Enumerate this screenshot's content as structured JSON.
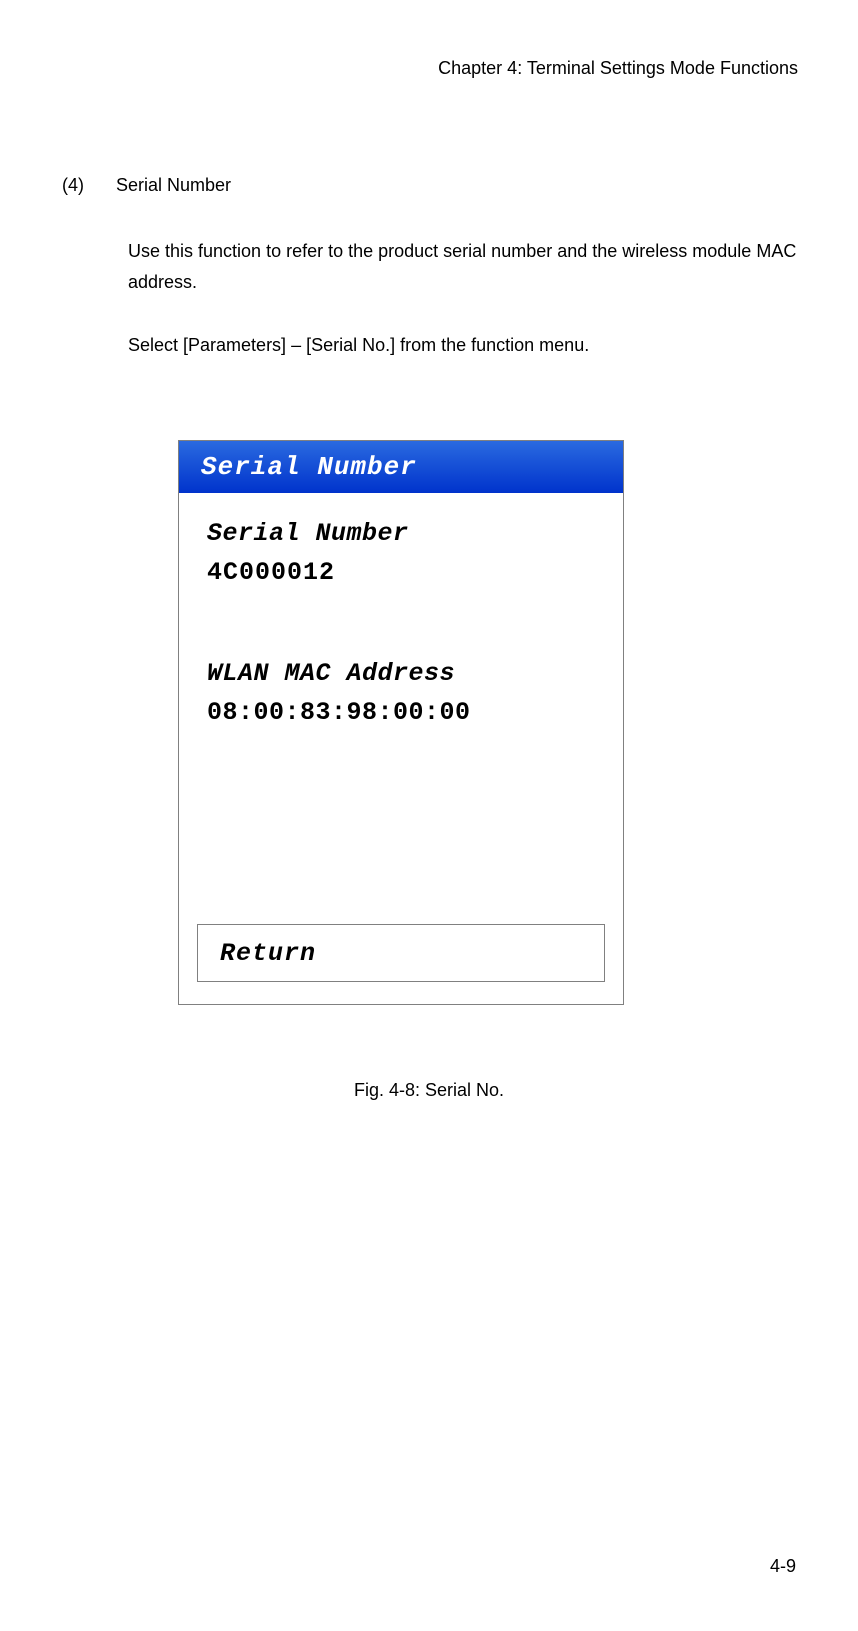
{
  "header": {
    "chapter": "Chapter 4: Terminal Settings Mode Functions"
  },
  "section": {
    "number": "(4)",
    "title": "Serial Number",
    "paragraph1": "Use this function to refer to the product serial number and the wireless module MAC address.",
    "paragraph2": "Select [Parameters] – [Serial No.] from the function menu."
  },
  "screenshot": {
    "title": "Serial Number",
    "serial_label": "Serial Number",
    "serial_value": "4C000012",
    "mac_label": "WLAN MAC Address",
    "mac_value": "08:00:83:98:00:00",
    "return_label": "Return"
  },
  "figure": {
    "caption": "Fig. 4-8: Serial No."
  },
  "footer": {
    "page_number": "4-9"
  }
}
